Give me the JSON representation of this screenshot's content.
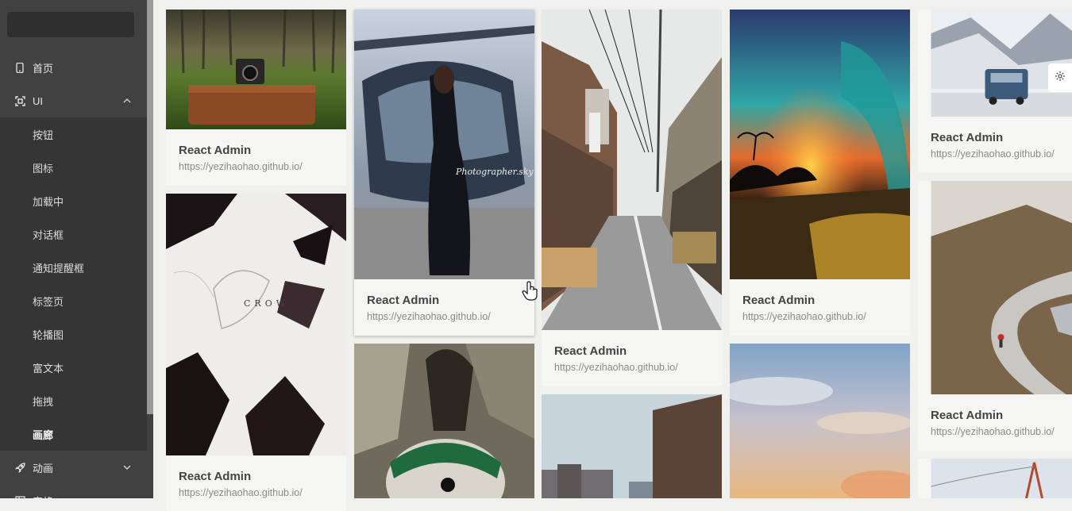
{
  "sidebar": {
    "items": [
      {
        "label": "首页",
        "icon": "mobile-icon"
      },
      {
        "label": "UI",
        "icon": "scan-icon",
        "expanded": true
      },
      {
        "label": "动画",
        "icon": "rocket-icon"
      },
      {
        "label": "表格",
        "icon": "table-icon"
      }
    ],
    "submenu": [
      "按钮",
      "图标",
      "加载中",
      "对话框",
      "通知提醒框",
      "标签页",
      "轮播图",
      "富文本",
      "拖拽",
      "画廊"
    ],
    "active_submenu": "画廊"
  },
  "gallery": {
    "card_title": "React Admin",
    "card_url": "https://yezihaohao.github.io/",
    "cards": [
      {
        "scene": "vintage suitcase and camera in forest",
        "title": "React Admin",
        "url": "https://yezihaohao.github.io/"
      },
      {
        "scene": "crow illustration",
        "title": "React Admin",
        "url": "https://yezihaohao.github.io/"
      },
      {
        "scene": "woman in black dress near helicopter",
        "title": "React Admin",
        "url": "https://yezihaohao.github.io/",
        "watermark": "Photographer.sky"
      },
      {
        "scene": "plush toy closeup",
        "title": "",
        "url": ""
      },
      {
        "scene": "japanese street with shops",
        "title": "React Admin",
        "url": "https://yezihaohao.github.io/"
      },
      {
        "scene": "city buildings",
        "title": "",
        "url": ""
      },
      {
        "scene": "colorful wave at sunset",
        "title": "React Admin",
        "url": "https://yezihaohao.github.io/"
      },
      {
        "scene": "sky with clouds",
        "title": "",
        "url": ""
      },
      {
        "scene": "truck in snowy mountains",
        "title": "React Admin",
        "url": "https://yezihaohao.github.io/"
      },
      {
        "scene": "skateboarder on mountain road",
        "title": "React Admin",
        "url": "https://yezihaohao.github.io/"
      },
      {
        "scene": "bridge",
        "title": "",
        "url": ""
      }
    ],
    "crow_text": "CROW"
  },
  "settings_icon": "gear-icon"
}
